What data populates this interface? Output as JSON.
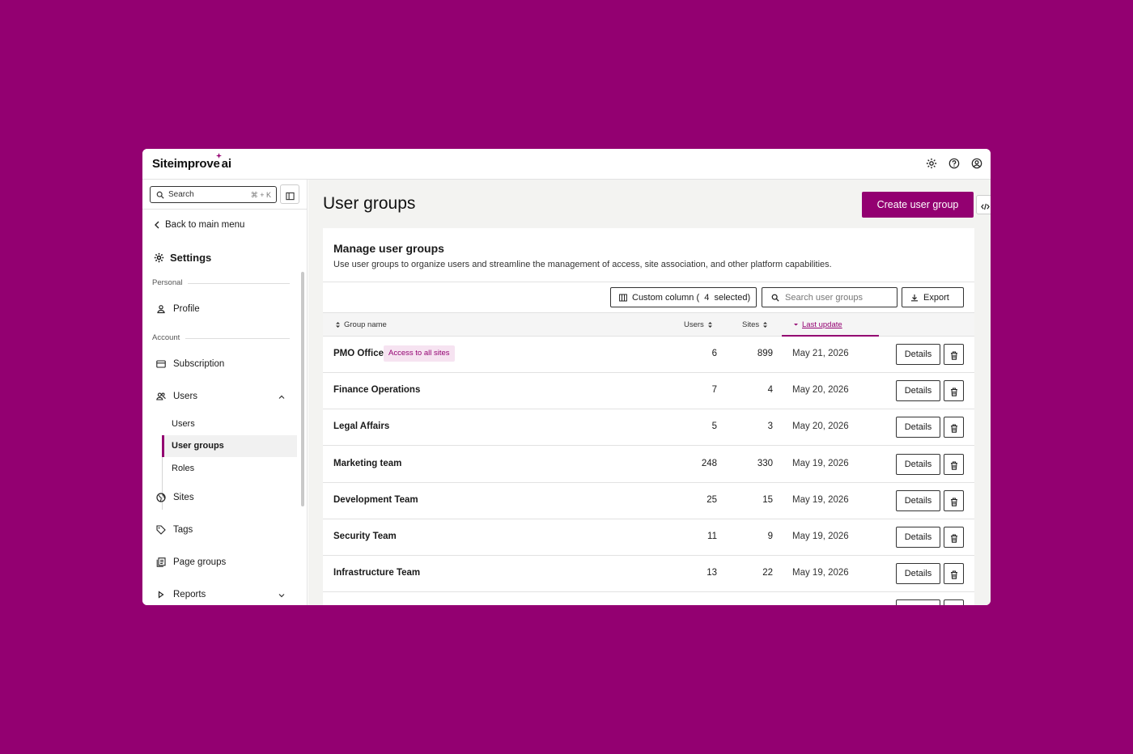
{
  "app": {
    "logo_text": "Siteimprove",
    "logo_suffix": "ai",
    "accent": "#930071",
    "top_icons": [
      "gear-icon",
      "help-icon",
      "user-circle-icon"
    ]
  },
  "sidebar": {
    "search_placeholder": "Search",
    "search_shortcut": "⌘ + K",
    "back_label": "Back to main menu",
    "settings_title": "Settings",
    "personal_label": "Personal",
    "account_label": "Account",
    "profile_label": "Profile",
    "subscription_label": "Subscription",
    "users_label": "Users",
    "sub_users": "Users",
    "sub_user_groups": "User groups",
    "sub_roles": "Roles",
    "sites_label": "Sites",
    "tags_label": "Tags",
    "page_groups_label": "Page groups",
    "reports_label": "Reports"
  },
  "main": {
    "page_title": "User groups",
    "create_label": "Create user group",
    "card_title": "Manage user groups",
    "card_desc": "Use user groups to organize users and streamline the management of access, site association, and other platform capabilities.",
    "custom_column_label": "Custom column (  4  selected)",
    "search_placeholder": "Search user groups",
    "export_label": "Export",
    "columns": {
      "group_name": "Group name",
      "users": "Users",
      "sites": "Sites",
      "last_update": "Last update"
    },
    "details_label": "Details",
    "rows": [
      {
        "name": "PMO Office",
        "badge": "Access to all sites",
        "users": "6",
        "sites": "899",
        "date": "May 21, 2026"
      },
      {
        "name": "Finance Operations",
        "users": "7",
        "sites": "4",
        "date": "May 20, 2026"
      },
      {
        "name": "Legal Affairs",
        "users": "5",
        "sites": "3",
        "date": "May 20, 2026"
      },
      {
        "name": "Marketing team",
        "users": "248",
        "sites": "330",
        "date": "May 19, 2026"
      },
      {
        "name": "Development Team",
        "users": "25",
        "sites": "15",
        "date": "May 19, 2026"
      },
      {
        "name": "Security Team",
        "users": "11",
        "sites": "9",
        "date": "May 19, 2026"
      },
      {
        "name": "Infrastructure Team",
        "users": "13",
        "sites": "22",
        "date": "May 19, 2026"
      }
    ]
  }
}
